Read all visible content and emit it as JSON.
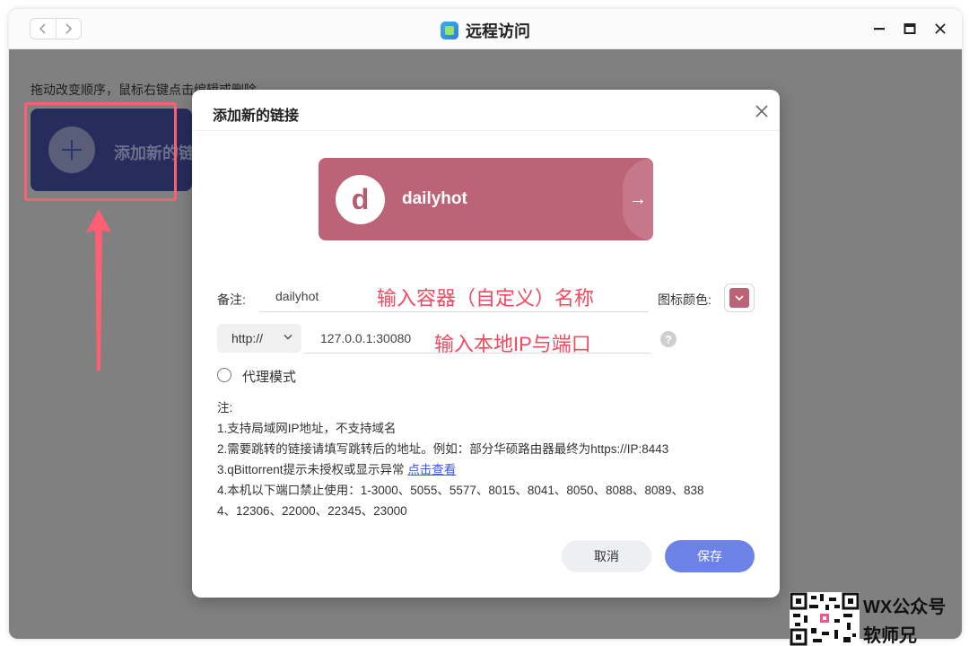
{
  "window": {
    "title": "远程访问",
    "hint": "拖动改变顺序，鼠标右键点击编辑或删除。",
    "add_card_label": "添加新的链接"
  },
  "modal": {
    "title": "添加新的链接",
    "preview": {
      "letter": "d",
      "name": "dailyhot",
      "color": "#bd6378"
    },
    "remark_label": "备注:",
    "remark_value": "dailyhot",
    "remark_annotation": "输入容器（自定义）名称",
    "icon_color_label": "图标颜色:",
    "protocol": "http://",
    "address_value": "127.0.0.1:30080",
    "address_annotation": "输入本地IP与端口",
    "proxy_label": "代理模式",
    "notes": {
      "heading": "注:",
      "line1": "1.支持局域网IP地址，不支持域名",
      "line2": "2.需要跳转的链接请填写跳转后的地址。例如：部分华硕路由器最终为https://IP:8443",
      "line3": "3.qBittorrent提示未授权或显示异常",
      "line3_link": "点击查看",
      "line4a": "4.本机以下端口禁止使用：1-3000、5055、5577、8015、8041、8050、8088、8089、838",
      "line4b": "4、12306、22000、22345、23000"
    },
    "cancel_label": "取消",
    "save_label": "保存"
  },
  "watermark": {
    "line1": "WX公众号",
    "line2": "软师兄"
  },
  "colors": {
    "accent": "#6d82e7",
    "annotation": "#f5485f",
    "card": "#262c5b"
  }
}
